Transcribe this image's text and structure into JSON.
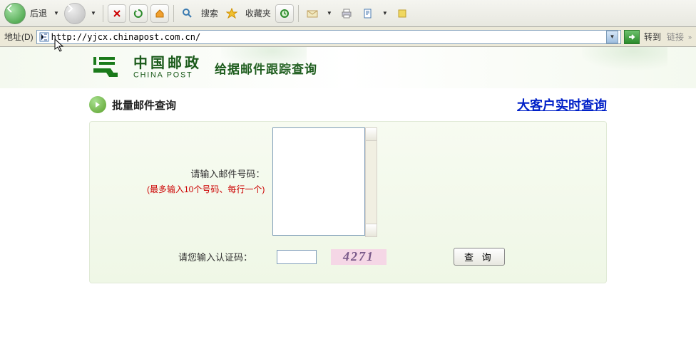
{
  "toolbar": {
    "back_label": "后退",
    "search_label": "搜索",
    "favorites_label": "收藏夹"
  },
  "addressbar": {
    "label": "地址(D)",
    "url": "http://yjcx.chinapost.com.cn/",
    "go_label": "转到",
    "links_label": "链接"
  },
  "logo": {
    "cn": "中国邮政",
    "en": "CHINA POST"
  },
  "tagline": "给据邮件跟踪查询",
  "section": {
    "title": "批量邮件查询",
    "big_link": "大客户实时查询"
  },
  "form": {
    "mail_label": "请输入邮件号码：",
    "mail_hint": "(最多输入10个号码、每行一个)",
    "captcha_label": "请您输入认证码：",
    "captcha_value": "4271",
    "query_btn": "查 询"
  }
}
